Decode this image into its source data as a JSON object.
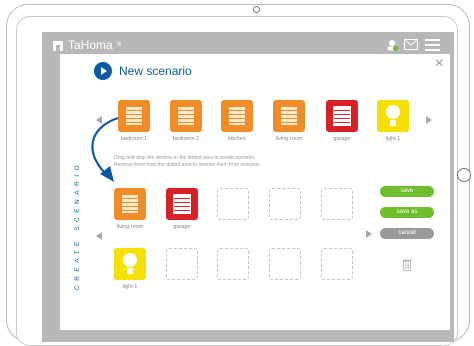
{
  "app": {
    "brand": "TaHoma",
    "brand_mark": "®"
  },
  "panel": {
    "title": "New scenario",
    "close_label": "×",
    "vertical_label": "CREATE SCENARIO",
    "instructions_line1": "Drag and drop the devices in the dotted area to create scenario.",
    "instructions_line2": "Remove them from the dotted area to remove them from scenario."
  },
  "devices": [
    {
      "label": "bedroom 1",
      "type": "shutter",
      "color": "#f28c28"
    },
    {
      "label": "bedroom 2",
      "type": "shutter",
      "color": "#f28c28"
    },
    {
      "label": "kitchen",
      "type": "shutter",
      "color": "#f28c28"
    },
    {
      "label": "living room",
      "type": "shutter",
      "color": "#f28c28"
    },
    {
      "label": "garage",
      "type": "garage-door",
      "color": "#d92027"
    },
    {
      "label": "light 1",
      "type": "light",
      "color": "#f6e000"
    }
  ],
  "scenario_slots": [
    {
      "label": "living room",
      "type": "shutter"
    },
    {
      "label": "garage",
      "type": "garage-door"
    },
    {
      "label": "light 1",
      "type": "light"
    }
  ],
  "actions": {
    "save": "save",
    "save_as": "save as",
    "cancel": "cancel"
  },
  "colors": {
    "accent": "#0b5aa8",
    "green": "#6fbe2e",
    "shutter_orange": "#f28c28",
    "garage_red": "#d92027",
    "light_yellow": "#f6e000",
    "user_status_green": "#6fbe2e"
  },
  "icons": {
    "logo": "house-icon",
    "user": "user-icon",
    "mail": "mail-icon",
    "menu": "hamburger-menu-icon",
    "trash": "trash-icon"
  }
}
